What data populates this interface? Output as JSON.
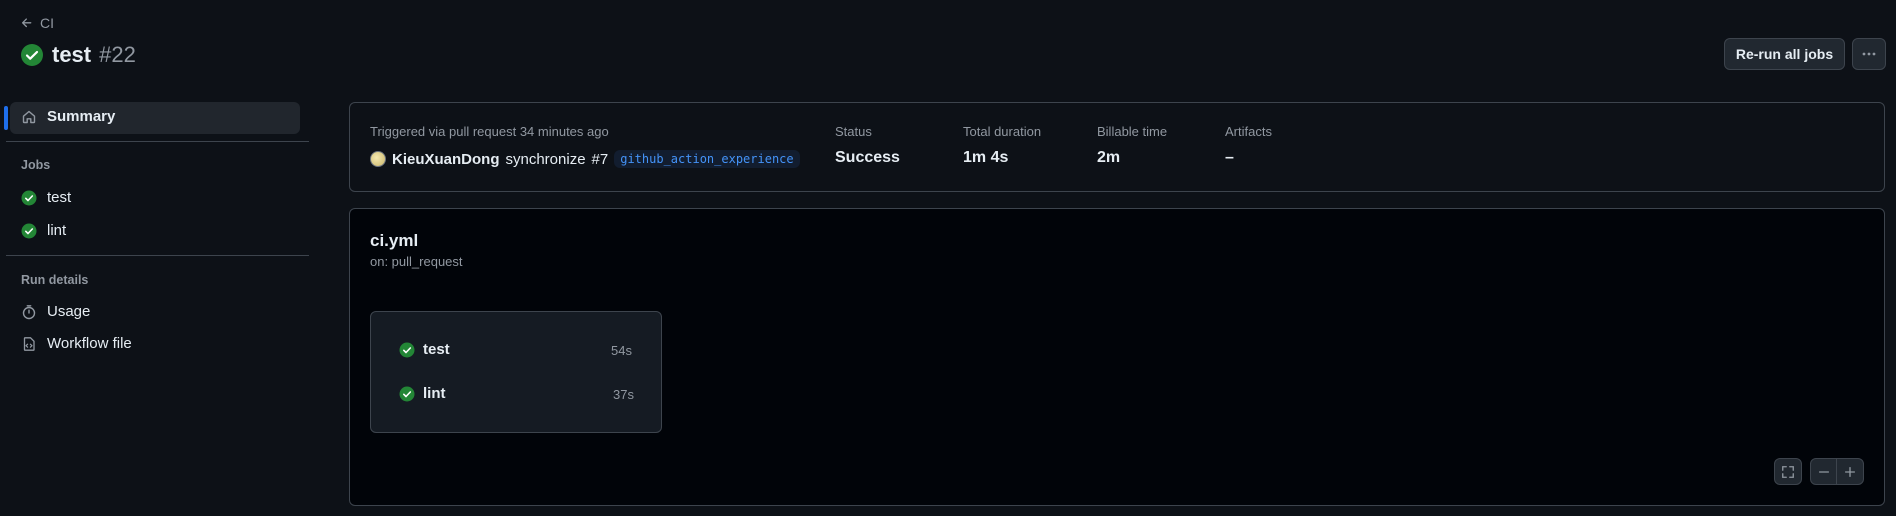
{
  "header": {
    "back_label": "CI",
    "title": "test",
    "run_number": "#22",
    "rerun_label": "Re-run all jobs",
    "more_label": "···"
  },
  "sidebar": {
    "summary_label": "Summary",
    "jobs_heading": "Jobs",
    "jobs": [
      {
        "label": "test"
      },
      {
        "label": "lint"
      }
    ],
    "run_details_heading": "Run details",
    "usage_label": "Usage",
    "workflow_file_label": "Workflow file"
  },
  "summary": {
    "trigger_text": "Triggered via pull request 34 minutes ago",
    "actor": "KieuXuanDong",
    "action": "synchronize",
    "pr": "#7",
    "branch": "github_action_experience",
    "status_label": "Status",
    "status_value": "Success",
    "duration_label": "Total duration",
    "duration_value": "1m 4s",
    "billable_label": "Billable time",
    "billable_value": "2m",
    "artifacts_label": "Artifacts",
    "artifacts_value": "–"
  },
  "workflow": {
    "file": "ci.yml",
    "on": "on: pull_request",
    "jobs": [
      {
        "name": "test",
        "time": "54s"
      },
      {
        "name": "lint",
        "time": "37s"
      }
    ]
  },
  "colors": {
    "success": "#238636",
    "accent": "#1f6feb",
    "background": "#0d1117"
  },
  "icons": {
    "back": "arrow-left-icon",
    "success": "check-circle-fill-icon",
    "home": "home-icon",
    "usage": "stopwatch-icon",
    "workflow_file": "file-code-icon",
    "fullscreen": "screen-full-icon",
    "zoom_out": "dash-icon",
    "zoom_in": "plus-icon"
  }
}
